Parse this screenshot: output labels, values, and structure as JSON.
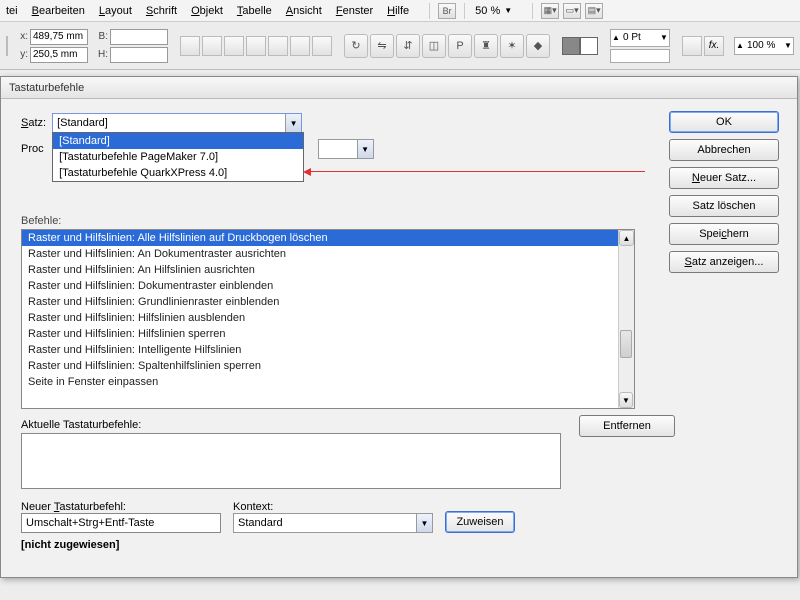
{
  "menu": {
    "items": [
      "tei",
      "Bearbeiten",
      "Layout",
      "Schrift",
      "Objekt",
      "Tabelle",
      "Ansicht",
      "Fenster",
      "Hilfe"
    ],
    "br": "Br",
    "zoom": "50 %"
  },
  "toolbar": {
    "x_label": "x:",
    "x_value": "489,75 mm",
    "y_label": "y:",
    "y_value": "250,5 mm",
    "b_label": "B:",
    "b_value": "",
    "h_label": "H:",
    "h_value": "",
    "stroke_value": "0 Pt",
    "opacity": "100 %",
    "p_glyph": "P"
  },
  "dialog": {
    "title": "Tastaturbefehle",
    "labels": {
      "satz": "Satz:",
      "proc": "Proc",
      "befehle": "Befehle:",
      "aktuelle": "Aktuelle Tastaturbefehle:",
      "neuer": "Neuer Tastaturbefehl:",
      "kontext": "Kontext:",
      "nicht_zugewiesen": "[nicht zugewiesen]"
    },
    "satz_selected": "[Standard]",
    "satz_options": [
      "[Standard]",
      "[Tastaturbefehle PageMaker 7.0]",
      "[Tastaturbefehle QuarkXPress 4.0]"
    ],
    "commands": [
      "Raster und Hilfslinien: Alle Hilfslinien auf Druckbogen löschen",
      "Raster und Hilfslinien: An Dokumentraster ausrichten",
      "Raster und Hilfslinien: An Hilfslinien ausrichten",
      "Raster und Hilfslinien: Dokumentraster einblenden",
      "Raster und Hilfslinien: Grundlinienraster einblenden",
      "Raster und Hilfslinien: Hilfslinien ausblenden",
      "Raster und Hilfslinien: Hilfslinien sperren",
      "Raster und Hilfslinien: Intelligente Hilfslinien",
      "Raster und Hilfslinien: Spaltenhilfslinien sperren",
      "Seite in Fenster einpassen"
    ],
    "neuer_value": "Umschalt+Strg+Entf-Taste",
    "kontext_value": "Standard",
    "buttons": {
      "ok": "OK",
      "abbrechen": "Abbrechen",
      "neuer_satz": "Neuer Satz...",
      "satz_loeschen": "Satz löschen",
      "speichern": "Speichern",
      "satz_anzeigen": "Satz anzeigen...",
      "entfernen": "Entfernen",
      "zuweisen": "Zuweisen"
    }
  }
}
